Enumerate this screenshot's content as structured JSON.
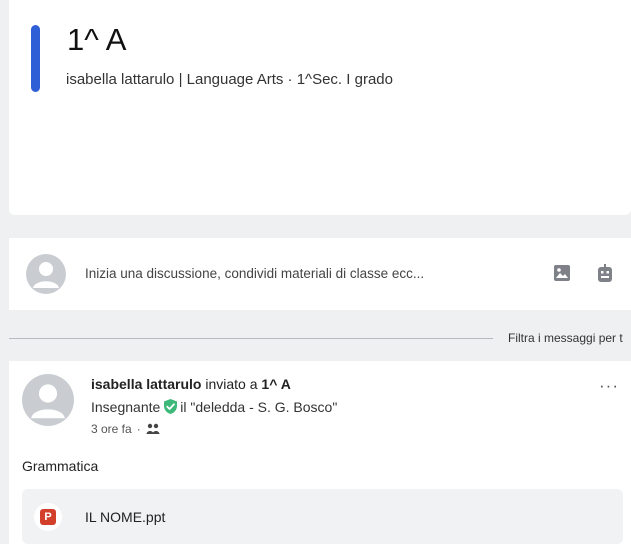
{
  "class_header": {
    "title": "1^ A",
    "subtitle": "isabella lattarulo | Language Arts  · 1^Sec. I grado",
    "accent_color": "#2f5fd6"
  },
  "composer": {
    "placeholder": "Inizia una discussione, condividi materiali di classe ecc...",
    "icons": [
      "image-icon",
      "robot-icon"
    ]
  },
  "filter": {
    "label": "Filtra i messaggi per t"
  },
  "post": {
    "author": "isabella lattarulo",
    "action": "inviato a",
    "target": "1^ A",
    "role": "Insegnante",
    "school": "il \"deledda - S. G. Bosco\"",
    "time": "3 ore fa",
    "separator": "·",
    "more": "···",
    "text": "Grammatica",
    "attachment": {
      "badge": "P",
      "name": "IL NOME.ppt"
    }
  },
  "colors": {
    "verified": "#3cb878",
    "ppt_badge": "#d2402c"
  }
}
